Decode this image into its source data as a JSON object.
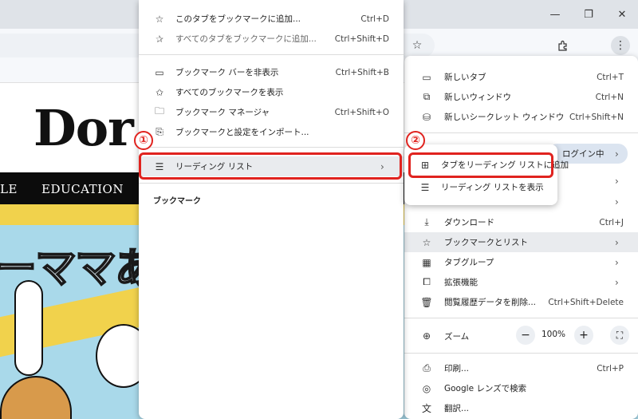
{
  "window": {
    "minimize_glyph": "—",
    "maximize_glyph": "❐",
    "close_glyph": "✕"
  },
  "toolbar": {
    "icons": [
      "star-icon",
      "extensions-icon",
      "more-icon"
    ]
  },
  "site": {
    "logo_text": "Dor",
    "nav": [
      "LE",
      "EDUCATION"
    ],
    "banner_text": "ーママあ"
  },
  "bookmark_menu": {
    "items": [
      {
        "label": "このタブをブックマークに追加...",
        "shortcut": "Ctrl+D",
        "icon": "star-icon"
      },
      {
        "label": "すべてのタブをブックマークに追加...",
        "shortcut": "Ctrl+Shift+D",
        "icon": "star-multi-icon"
      },
      {
        "label": "ブックマーク バーを非表示",
        "shortcut": "Ctrl+Shift+B",
        "icon": "bookmark-bar-icon"
      },
      {
        "label": "すべてのブックマークを表示",
        "shortcut": "",
        "icon": "star-list-icon"
      },
      {
        "label": "ブックマーク マネージャ",
        "shortcut": "Ctrl+Shift+O",
        "icon": "folder-star-icon"
      },
      {
        "label": "ブックマークと設定をインポート...",
        "shortcut": "",
        "icon": "import-icon"
      },
      {
        "label": "リーディング リスト",
        "shortcut": "",
        "icon": "reading-list-icon"
      }
    ],
    "section_label": "ブックマーク"
  },
  "main_menu": {
    "items": [
      {
        "label": "新しいタブ",
        "shortcut": "Ctrl+T",
        "icon": "new-tab-icon"
      },
      {
        "label": "新しいウィンドウ",
        "shortcut": "Ctrl+N",
        "icon": "new-window-icon"
      },
      {
        "label": "新しいシークレット ウィンドウ",
        "shortcut": "Ctrl+Shift+N",
        "icon": "incognito-icon"
      },
      {
        "label": "ログイン中",
        "shortcut": "",
        "icon": ""
      },
      {
        "label": "ダウンロード",
        "shortcut": "Ctrl+J",
        "icon": "download-icon"
      },
      {
        "label": "ブックマークとリスト",
        "shortcut": "",
        "icon": "star-icon"
      },
      {
        "label": "タブグループ",
        "shortcut": "",
        "icon": "tab-groups-icon"
      },
      {
        "label": "拡張機能",
        "shortcut": "",
        "icon": "extension-icon"
      },
      {
        "label": "閲覧履歴データを削除...",
        "shortcut": "Ctrl+Shift+Delete",
        "icon": "trash-icon"
      },
      {
        "label": "印刷...",
        "shortcut": "Ctrl+P",
        "icon": "print-icon"
      },
      {
        "label": "Google レンズで検索",
        "shortcut": "",
        "icon": "lens-icon"
      },
      {
        "label": "翻訳...",
        "shortcut": "",
        "icon": "translate-icon"
      }
    ],
    "zoom": {
      "label": "ズーム",
      "value": "100%",
      "minus": "−",
      "plus": "+"
    }
  },
  "reading_list_menu": {
    "items": [
      {
        "label": "タブをリーディング リストに追加",
        "icon": "add-reading-icon"
      },
      {
        "label": "リーディング リストを表示",
        "icon": "reading-list-icon"
      }
    ]
  },
  "annotations": {
    "badge1": "①",
    "badge2": "②",
    "accent_color": "#e0231f"
  }
}
